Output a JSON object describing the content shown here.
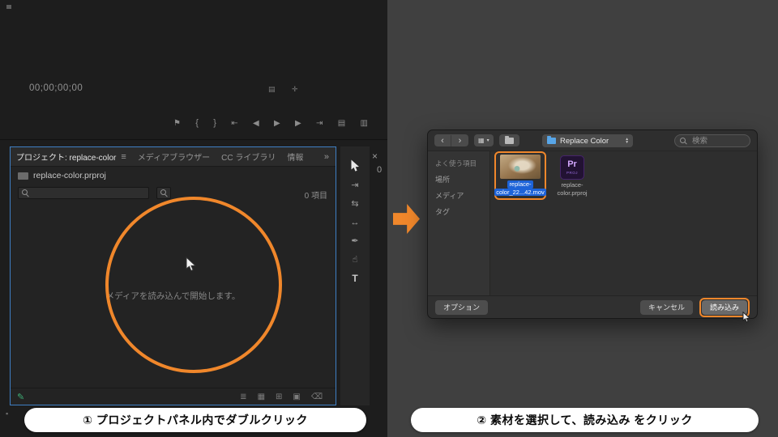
{
  "accent": "#f0872b",
  "steps": {
    "step1": "① プロジェクトパネル内でダブルクリック",
    "step2": "② 素材を選択して、読み込み をクリック"
  },
  "premiere": {
    "status_icon": "▪",
    "monitor": {
      "timecode": "00;00;00;00",
      "settings_icon": "▤",
      "snap_icon": "✛"
    },
    "transport": {
      "marker": "⚑",
      "mark_in": "{",
      "mark_out": "}",
      "go_to_in": "⇤",
      "step_back": "◀",
      "play": "▶",
      "step_forward": "▶",
      "go_to_out": "⇥",
      "lift": "▤",
      "extract": "▥"
    },
    "panel": {
      "tabs": [
        {
          "label": "プロジェクト: replace-color"
        },
        {
          "label": "メディアブラウザー"
        },
        {
          "label": "CC ライブラリ"
        },
        {
          "label": "情報"
        }
      ],
      "menu_icon": "≡",
      "overflow_icon": "»",
      "close_icon": "×",
      "clipped_digit": "0",
      "project_file": "replace-color.prproj",
      "item_count": "0 項目",
      "empty_message": "メディアを読み込んで開始します。"
    },
    "tools": {
      "track_select": "⇥",
      "ripple_edit": "⇆",
      "rate_stretch": "↔",
      "pen": "✒",
      "hand": "☝",
      "type": "T"
    },
    "footer": {
      "pencil": "✎",
      "list_view": "≣",
      "icon_view": "▦",
      "new_bin": "⊞",
      "new_item": "▣",
      "delete": "⌫"
    }
  },
  "dialog": {
    "toolbar": {
      "back": "‹",
      "forward": "›",
      "view_grid": "▦",
      "view_caret": "▾",
      "location": "Replace Color",
      "chevron_up": "▴",
      "chevron_down": "▾",
      "search_placeholder": "検索"
    },
    "sidebar": [
      {
        "label": "よく使う項目"
      },
      {
        "label": "場所"
      },
      {
        "label": "メディア"
      },
      {
        "label": "タグ"
      }
    ],
    "pr_icon": {
      "text": "Pr",
      "sub": "PROJ"
    },
    "files": [
      {
        "line1": "replace-",
        "line2": "color_22...42.mov"
      },
      {
        "line1": "replace-",
        "line2": "color.prproj"
      }
    ],
    "buttons": {
      "options": "オプション",
      "cancel": "キャンセル",
      "import": "読み込み"
    }
  }
}
